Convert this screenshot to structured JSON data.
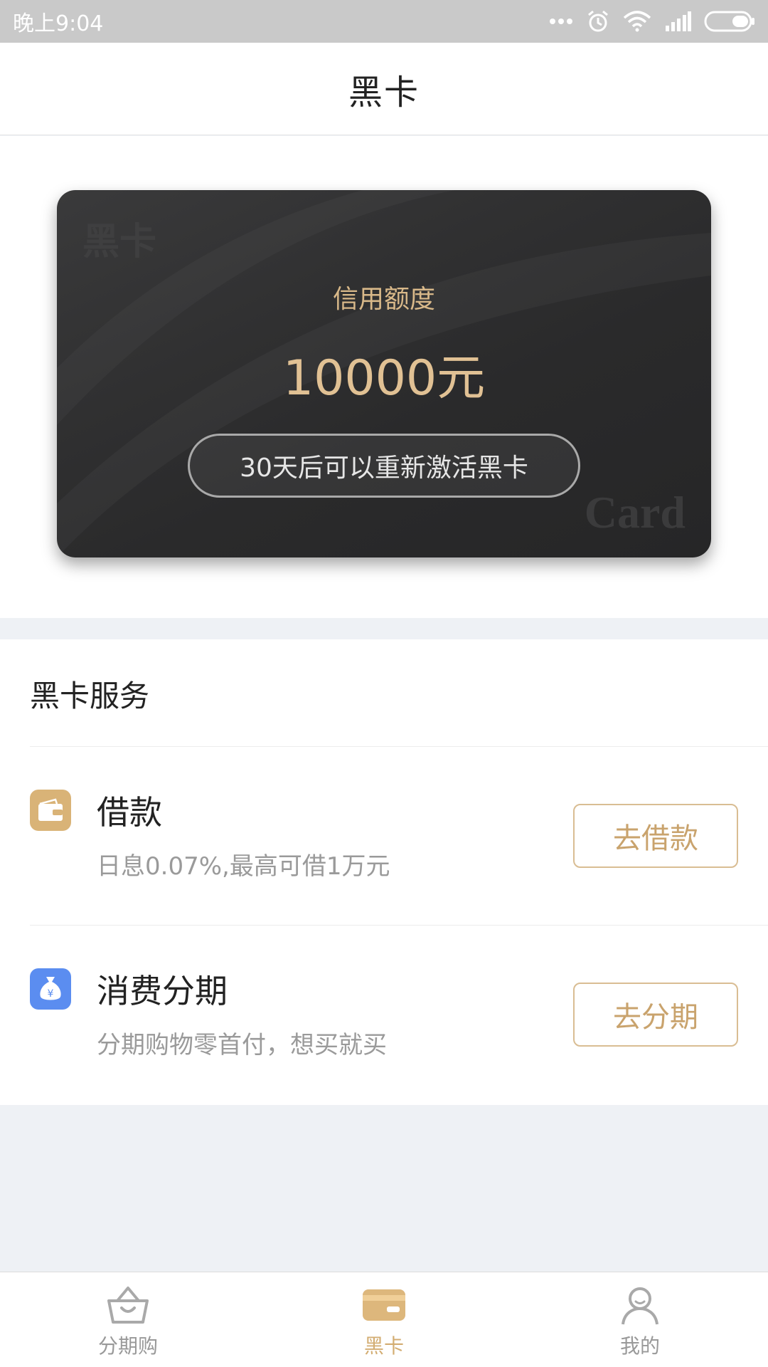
{
  "status_bar": {
    "time": "晚上9:04",
    "icons": [
      "more-dots-icon",
      "alarm-icon",
      "wifi-icon",
      "signal-icon",
      "battery-icon"
    ]
  },
  "header": {
    "title": "黑卡"
  },
  "card": {
    "watermark_top": "黑卡",
    "watermark_bottom": "Card",
    "label": "信用额度",
    "amount": "10000元",
    "reactivate_text": "30天后可以重新激活黑卡"
  },
  "services": {
    "title": "黑卡服务",
    "items": [
      {
        "icon": "wallet-icon",
        "name": "借款",
        "desc": "日息0.07%,最高可借1万元",
        "button": "去借款",
        "icon_color": "#d9b377"
      },
      {
        "icon": "money-bag-icon",
        "name": "消费分期",
        "desc": "分期购物零首付，想买就买",
        "button": "去分期",
        "icon_color": "#5b8df0"
      }
    ]
  },
  "bottom_nav": {
    "items": [
      {
        "label": "分期购",
        "icon": "basket-icon",
        "active": false
      },
      {
        "label": "黑卡",
        "icon": "card-icon",
        "active": true
      },
      {
        "label": "我的",
        "icon": "user-icon",
        "active": false
      }
    ]
  },
  "colors": {
    "accent_gold": "#d3ad72",
    "card_bg": "#2c2c2d",
    "page_bg": "#eef1f5"
  }
}
